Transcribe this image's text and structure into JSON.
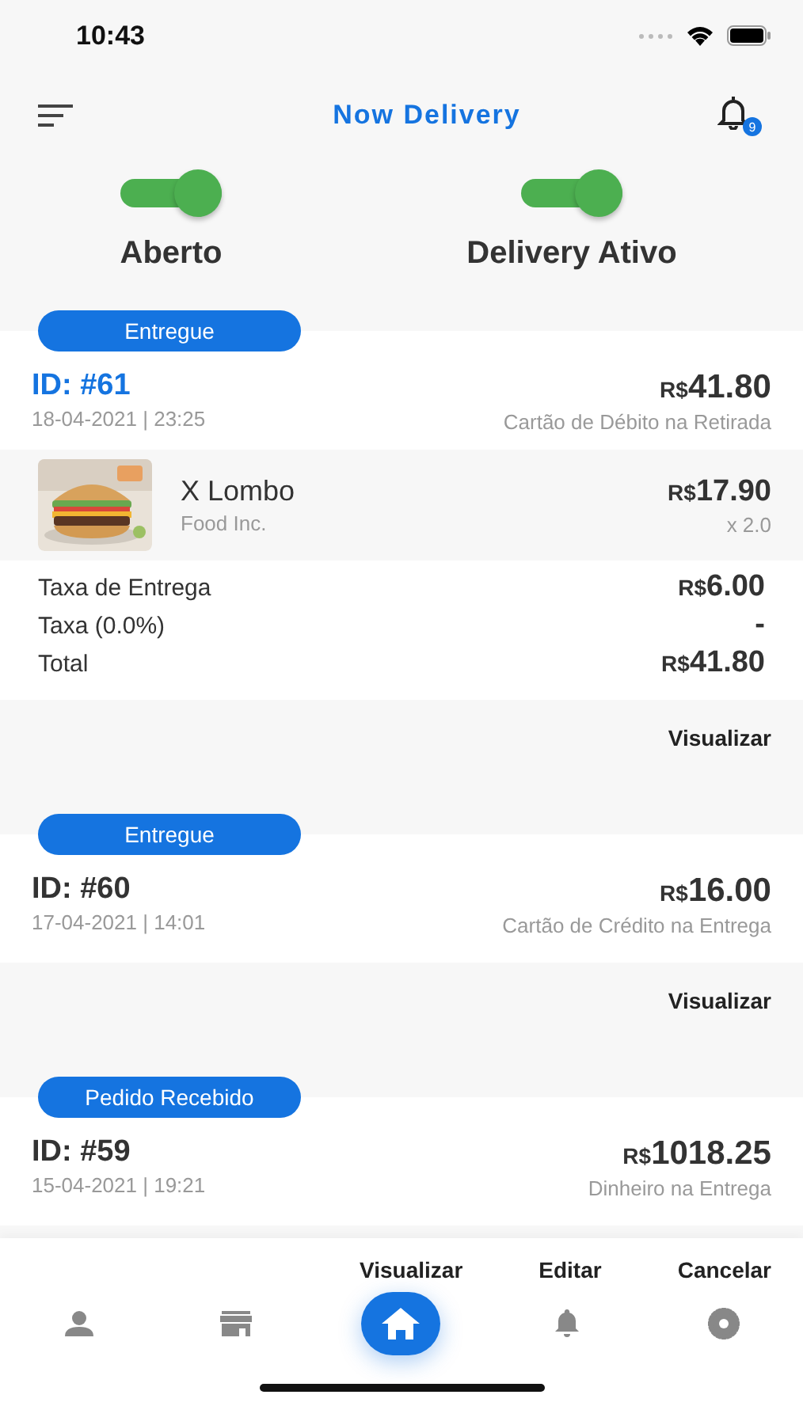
{
  "status_bar": {
    "time": "10:43"
  },
  "header": {
    "title": "Now Delivery",
    "notification_count": "9"
  },
  "toggles": [
    {
      "label": "Aberto",
      "on": true
    },
    {
      "label": "Delivery Ativo",
      "on": true
    }
  ],
  "orders": [
    {
      "status": "Entregue",
      "id": "ID: #61",
      "id_highlighted": true,
      "date": "18-04-2021 | 23:25",
      "currency": "R$",
      "amount": "41.80",
      "payment": "Cartão de Débito na Retirada",
      "items": [
        {
          "kind": "picture",
          "name": "X Lombo",
          "vendor": "Food Inc.",
          "currency": "R$",
          "price": "17.90",
          "quantity": "x 2.0"
        }
      ],
      "summary": [
        {
          "label": "Taxa de Entrega",
          "currency": "R$",
          "value": "6.00"
        },
        {
          "label": "Taxa (0.0%)",
          "value": "-"
        },
        {
          "label": "Total",
          "currency": "R$",
          "value": "41.80"
        }
      ],
      "actions": [
        "Visualizar"
      ]
    },
    {
      "status": "Entregue",
      "id": "ID: #60",
      "id_highlighted": false,
      "date": "17-04-2021 | 14:01",
      "currency": "R$",
      "amount": "16.00",
      "payment": "Cartão de Crédito na Entrega",
      "actions": [
        "Visualizar"
      ]
    },
    {
      "status": "Pedido Recebido",
      "id": "ID: #59",
      "id_highlighted": false,
      "date": "15-04-2021 | 19:21",
      "currency": "R$",
      "amount": "1018.25",
      "payment": "Dinheiro na Entrega"
    }
  ],
  "footer": {
    "actions": [
      "Visualizar",
      "Editar",
      "Cancelar"
    ],
    "nav": [
      {
        "kind": "person",
        "selected": false
      },
      {
        "kind": "store",
        "selected": false
      },
      {
        "kind": "home",
        "selected": true
      },
      {
        "kind": "bell",
        "selected": false
      },
      {
        "kind": "gear",
        "selected": false
      }
    ]
  }
}
